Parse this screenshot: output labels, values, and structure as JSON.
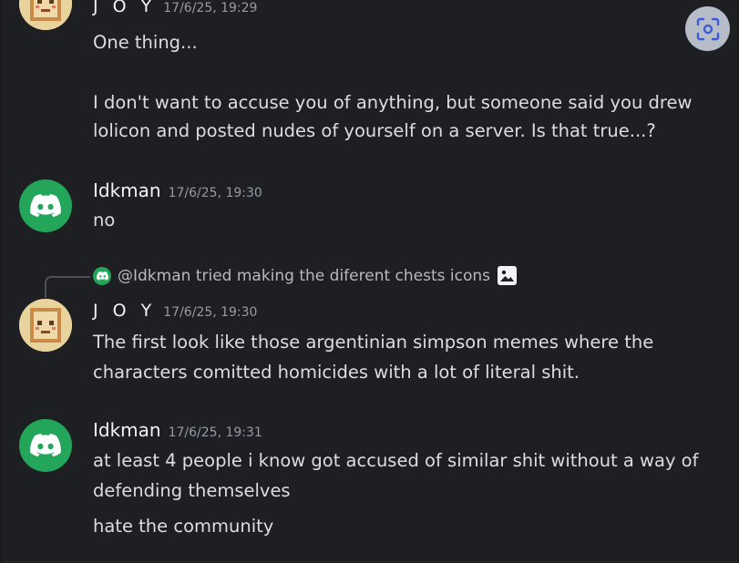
{
  "messages": [
    {
      "author": "J O Y",
      "timestamp": "17/6/25, 19:29",
      "avatar": "joy-avatar",
      "lines": [
        "One thing...",
        "",
        "I don't want to accuse you of anything, but someone said you drew",
        "lolicon and posted nudes of yourself on a server. Is that true...?"
      ]
    },
    {
      "author": "Idkman",
      "timestamp": "17/6/25, 19:30",
      "avatar": "discord-icon",
      "lines": [
        "no"
      ]
    },
    {
      "reply_to": {
        "mention": "@Idkman",
        "text": "tried making the diferent chests icons",
        "attachment_icon": "image-icon"
      },
      "author": "J O Y",
      "timestamp": "17/6/25, 19:30",
      "avatar": "joy-avatar",
      "lines": [
        "The first look like those argentinian simpson memes where the",
        "characters comitted homicides with a lot of literal shit."
      ]
    },
    {
      "author": "Idkman",
      "timestamp": "17/6/25, 19:31",
      "avatar": "discord-icon",
      "lines": [
        "at least 4 people i know got accused of similar shit without a way of",
        "defending themselves"
      ]
    },
    {
      "author": "",
      "timestamp": "",
      "lines": [
        "hate the community"
      ]
    }
  ],
  "overlay": {
    "lens_button_icon": "lens-scan-icon"
  },
  "colors": {
    "discord_green": "#23a55a",
    "background": "#1e1f23",
    "text": "#dbdee1",
    "muted": "#949ba4"
  }
}
